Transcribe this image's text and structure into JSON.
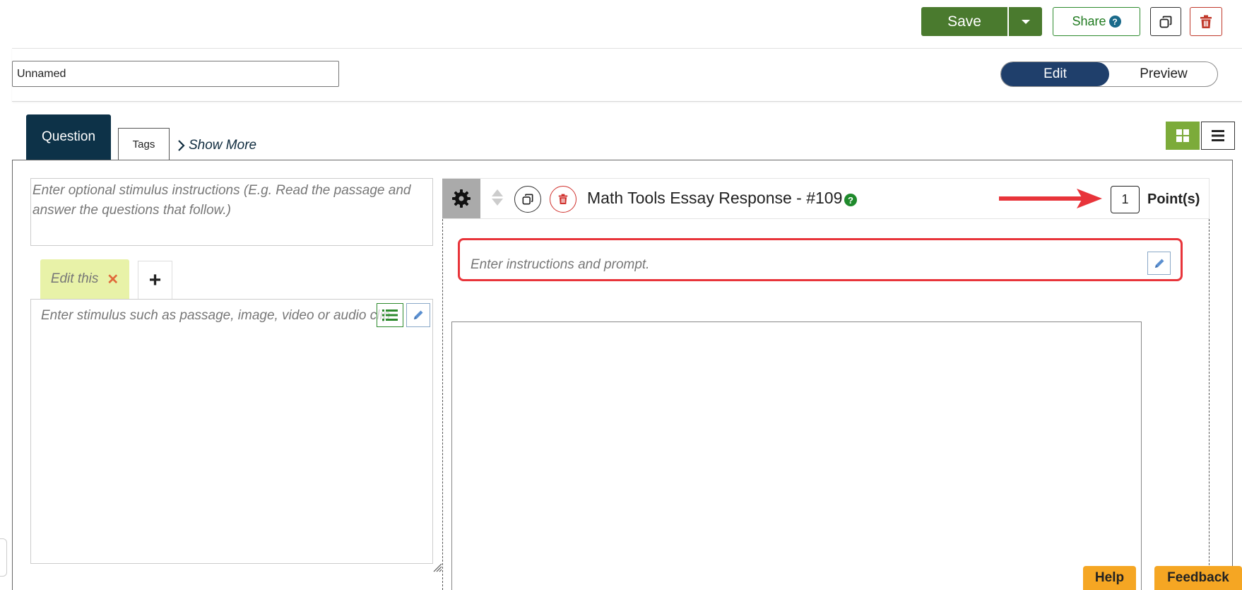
{
  "toolbar": {
    "save_label": "Save",
    "share_label": "Share",
    "share_help": "?"
  },
  "header": {
    "name_value": "Unnamed",
    "mode_edit": "Edit",
    "mode_preview": "Preview",
    "mode_selected": "Edit"
  },
  "tabs": [
    {
      "label": "Question",
      "active": true
    },
    {
      "label": "Tags",
      "active": false
    }
  ],
  "show_more_label": "Show More",
  "stimulus": {
    "instructions_placeholder": "Enter optional stimulus instructions (E.g. Read the passage and answer the questions that follow.)",
    "tab_label": "Edit this",
    "tab_add": "+",
    "content_placeholder": "Enter stimulus such as passage, image, video or audio clip"
  },
  "question": {
    "title": "Math Tools Essay Response - #109",
    "help": "?",
    "points_value": "1",
    "points_label": "Point(s)",
    "prompt_placeholder": "Enter instructions and prompt."
  },
  "footer": {
    "help_label": "Help",
    "feedback_label": "Feedback"
  },
  "colors": {
    "save_green": "#4a7a2e",
    "toggle_active": "#1f3f6b",
    "question_tab": "#0d3248",
    "stimulus_tab": "#e8f2a8",
    "layout_active": "#7cab3a",
    "highlight_red": "#e8343a",
    "help_orange": "#f5a623"
  },
  "icons": {
    "copy": "copy-icon",
    "trash": "trash-icon",
    "gear": "gear-icon",
    "sort": "sort-icon",
    "pencil": "pencil-icon",
    "list": "list-icon",
    "grid": "grid-icon",
    "chevron": "chevron-right-icon",
    "arrow": "arrow-right-icon"
  }
}
